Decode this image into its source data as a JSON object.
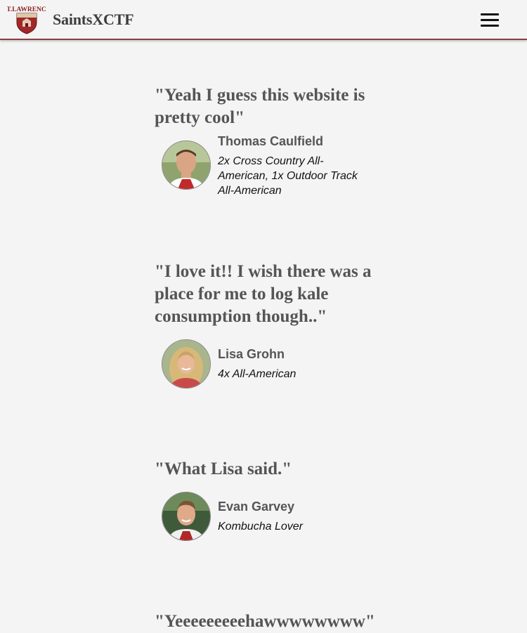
{
  "header": {
    "brand": "SaintsXCTF",
    "logo_icon": "st-lawrence-shield-logo",
    "logo_text_top": "ST.LAWRENCE",
    "menu_icon": "hamburger-menu-icon"
  },
  "testimonials": [
    {
      "quote": "\"Yeah I guess this website is pretty cool\"",
      "name": "Thomas Caulfield",
      "description": "2x Cross Country All-American, 1x Outdoor Track All-American"
    },
    {
      "quote": "\"I love it!! I wish there was a place for me to log kale consumption though..\"",
      "name": "Lisa Grohn",
      "description": "4x All-American"
    },
    {
      "quote": "\"What Lisa said.\"",
      "name": "Evan Garvey",
      "description": "Kombucha Lover"
    },
    {
      "quote": "\"Yeeeeeeeeehawwwwwwww\""
    }
  ]
}
